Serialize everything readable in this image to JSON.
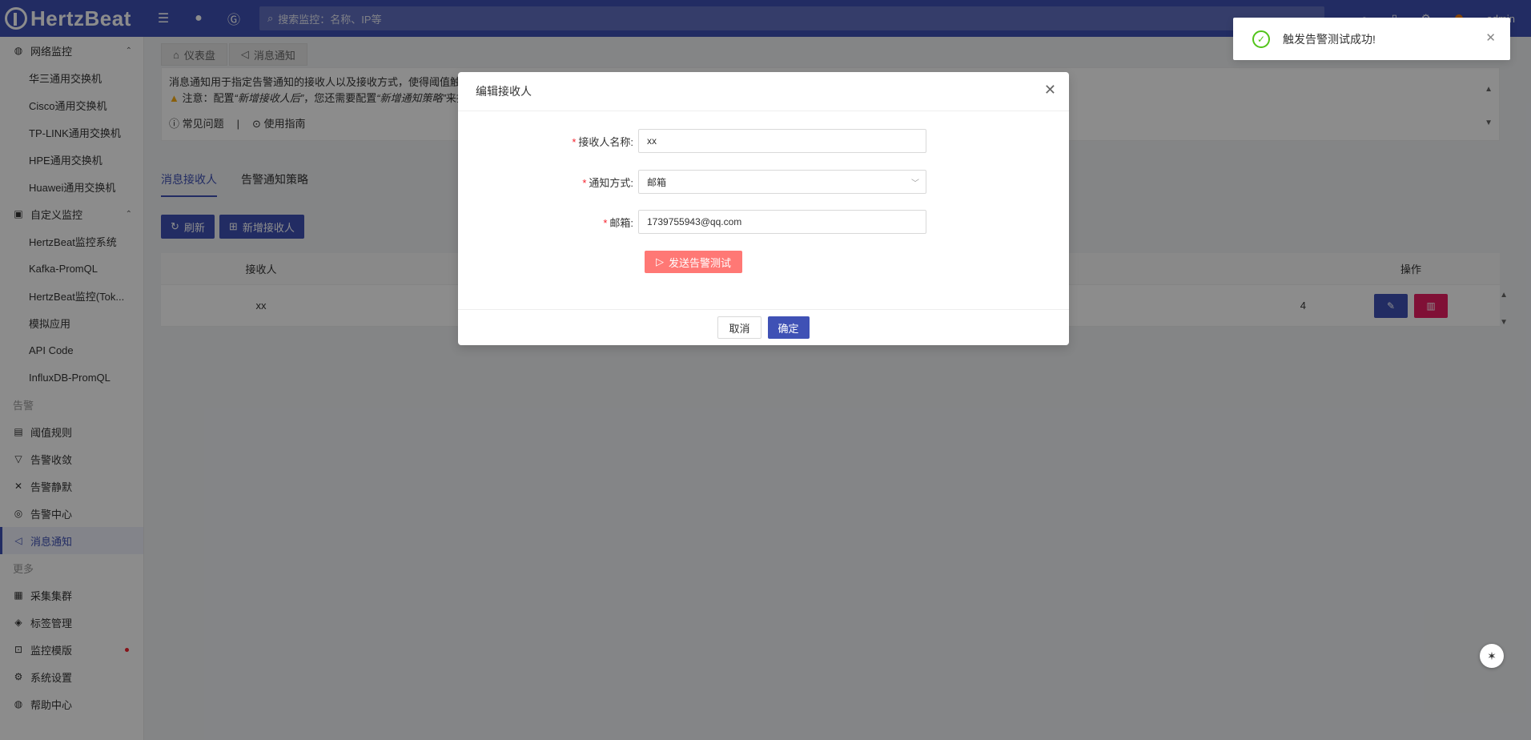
{
  "header": {
    "logo_text": "HertzBeat",
    "search_placeholder": "搜索监控：名称、IP等",
    "user": "admin"
  },
  "sidebar": {
    "group_network": "网络监控",
    "network_items": [
      "华三通用交换机",
      "Cisco通用交换机",
      "TP-LINK通用交换机",
      "HPE通用交换机",
      "Huawei通用交换机"
    ],
    "group_custom": "自定义监控",
    "custom_items": [
      "HertzBeat监控系统",
      "Kafka-PromQL",
      "HertzBeat监控(Tok...",
      "模拟应用",
      "API Code",
      "InfluxDB-PromQL"
    ],
    "title_alert": "告警",
    "alert_items": [
      "阈值规则",
      "告警收敛",
      "告警静默",
      "告警中心",
      "消息通知"
    ],
    "title_more": "更多",
    "more_items": [
      "采集集群",
      "标签管理",
      "监控模版",
      "系统设置",
      "帮助中心"
    ]
  },
  "page_tabs": [
    "仪表盘",
    "消息通知"
  ],
  "notice": {
    "line1": "消息通知用于指定告警通知的接收人以及接收方式，使得阈值触发",
    "line2_prefix": "注意：配置",
    "line2_em1": "“新增接收人后”",
    "line2_mid": "，您还需要配置",
    "line2_em2": "“新增通知策略”",
    "line2_suffix": "来指",
    "faq": "常见问题",
    "separator": "|",
    "guide": "使用指南"
  },
  "inner_tabs": [
    "消息接收人",
    "告警通知策略"
  ],
  "buttons": {
    "refresh": "刷新",
    "add_receiver": "新增接收人"
  },
  "table": {
    "headers": [
      "接收人",
      "操作"
    ],
    "rows": [
      {
        "name": "xx",
        "mid_fragment": "4"
      }
    ]
  },
  "modal": {
    "title": "编辑接收人",
    "name_label": "接收人名称:",
    "name_value": "xx",
    "method_label": "通知方式:",
    "method_value": "邮箱",
    "email_label": "邮箱:",
    "email_value": "1739755943@qq.com",
    "test_button": "发送告警测试",
    "cancel": "取消",
    "ok": "确定"
  },
  "toast": {
    "message": "触发告警测试成功!"
  }
}
